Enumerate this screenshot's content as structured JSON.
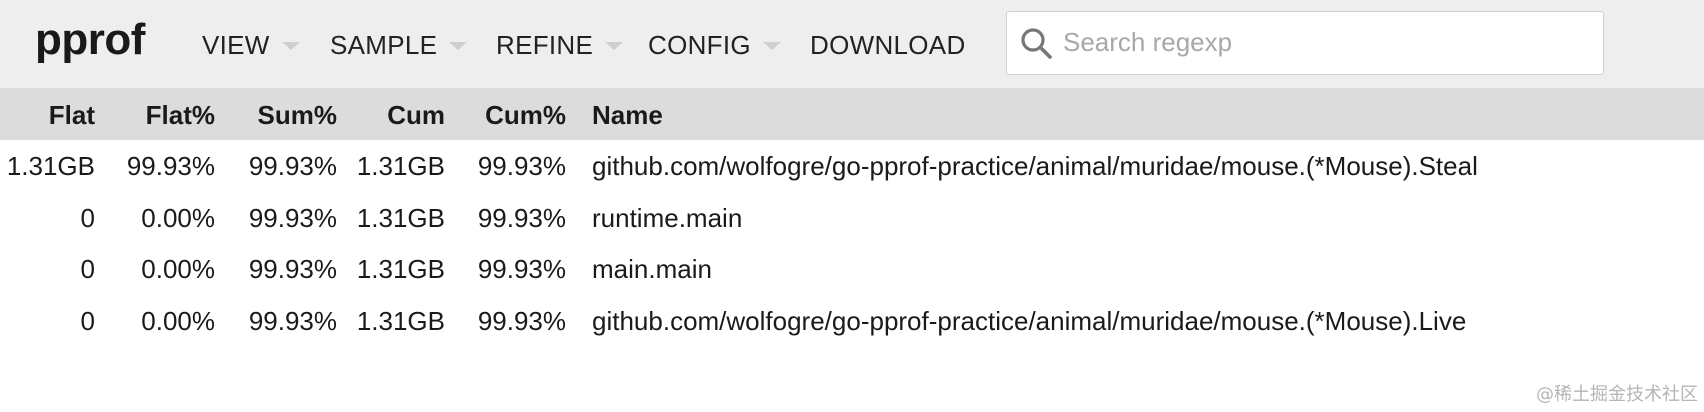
{
  "app": {
    "logo": "pprof"
  },
  "menu": {
    "view": "VIEW",
    "sample": "SAMPLE",
    "refine": "REFINE",
    "config": "CONFIG",
    "download": "DOWNLOAD"
  },
  "search": {
    "placeholder": "Search regexp",
    "value": "",
    "icon": "search-icon"
  },
  "table": {
    "columns": [
      "Flat",
      "Flat%",
      "Sum%",
      "Cum",
      "Cum%",
      "Name"
    ],
    "rows": [
      {
        "flat": "1.31GB",
        "flat_pct": "99.93%",
        "sum_pct": "99.93%",
        "cum": "1.31GB",
        "cum_pct": "99.93%",
        "name": "github.com/wolfogre/go-pprof-practice/animal/muridae/mouse.(*Mouse).Steal"
      },
      {
        "flat": "0",
        "flat_pct": "0.00%",
        "sum_pct": "99.93%",
        "cum": "1.31GB",
        "cum_pct": "99.93%",
        "name": "runtime.main"
      },
      {
        "flat": "0",
        "flat_pct": "0.00%",
        "sum_pct": "99.93%",
        "cum": "1.31GB",
        "cum_pct": "99.93%",
        "name": "main.main"
      },
      {
        "flat": "0",
        "flat_pct": "0.00%",
        "sum_pct": "99.93%",
        "cum": "1.31GB",
        "cum_pct": "99.93%",
        "name": "github.com/wolfogre/go-pprof-practice/animal/muridae/mouse.(*Mouse).Live"
      }
    ]
  },
  "watermark": "@稀土掘金技术社区",
  "colors": {
    "header_bg": "#eeeeee",
    "table_header_bg": "#dcdcdc",
    "text": "#1a1a1a",
    "placeholder": "#a8a8a8"
  }
}
